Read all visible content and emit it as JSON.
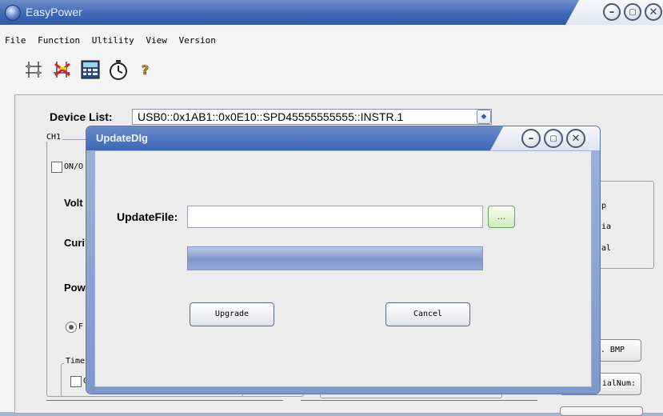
{
  "app": {
    "title": "EasyPower"
  },
  "menu": [
    "File",
    "Function",
    "Ultility",
    "View",
    "Version"
  ],
  "toolbar": {
    "icons": [
      "connect-icon",
      "disconnect-icon",
      "calculator-icon",
      "timer-icon",
      "help-icon"
    ]
  },
  "device": {
    "label": "Device List:",
    "value": "USB0::0x1AB1::0x0E10::SPD45555555555::INSTR.1"
  },
  "background": {
    "ch1_group": "CH1",
    "onoff": "ON/O",
    "volt": "Volt",
    "curr": "Curi",
    "pow": "Pow",
    "radio": "F",
    "timer_group": "Time",
    "timer_check": "O:",
    "right_items": [
      "p",
      "ia",
      "al"
    ],
    "right_buttons": [
      ". BMP",
      "ialNum:"
    ]
  },
  "dialog": {
    "title": "UpdateDlg",
    "update_label": "UpdateFile:",
    "file_value": "",
    "browse_label": "...",
    "progress": 0,
    "upgrade_label": "Upgrade",
    "cancel_label": "Cancel"
  },
  "colors": {
    "titlebar": "#3e66b3",
    "dialog_frame": "#7c99cc",
    "progress": "#7e96c8"
  }
}
